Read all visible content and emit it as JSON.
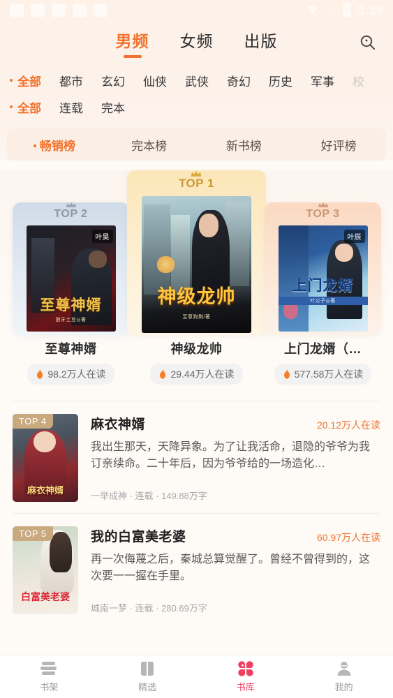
{
  "status_bar": {
    "time": "3:39",
    "icons": [
      "wifi-icon",
      "signal-icon",
      "battery-charging-icon"
    ]
  },
  "header": {
    "tabs": [
      {
        "label": "男频",
        "active": true
      },
      {
        "label": "女频",
        "active": false
      },
      {
        "label": "出版",
        "active": false
      }
    ],
    "search_icon": "search-icon"
  },
  "filters": {
    "genre_row": [
      {
        "label": "全部",
        "active": true
      },
      {
        "label": "都市",
        "active": false
      },
      {
        "label": "玄幻",
        "active": false
      },
      {
        "label": "仙侠",
        "active": false
      },
      {
        "label": "武侠",
        "active": false
      },
      {
        "label": "奇幻",
        "active": false
      },
      {
        "label": "历史",
        "active": false
      },
      {
        "label": "军事",
        "active": false
      },
      {
        "label": "校",
        "active": false,
        "clipped": true
      }
    ],
    "status_row": [
      {
        "label": "全部",
        "active": true
      },
      {
        "label": "连载",
        "active": false
      },
      {
        "label": "完本",
        "active": false
      }
    ]
  },
  "rank_tabs": [
    {
      "label": "畅销榜",
      "active": true
    },
    {
      "label": "完本榜",
      "active": false
    },
    {
      "label": "新书榜",
      "active": false
    },
    {
      "label": "好评榜",
      "active": false
    }
  ],
  "podium": [
    {
      "rank_label": "TOP 1",
      "title": "神级龙帅",
      "readers": "29.44万人在读",
      "cover_title": "神级龙帅",
      "cover_author": "至尊狗剩/著",
      "cover_badge": ""
    },
    {
      "rank_label": "TOP 2",
      "title": "至尊神婿",
      "readers": "98.2万人在读",
      "cover_title": "至尊神婿",
      "cover_author": "狼牙土豆◎著",
      "cover_badge": "叶昊"
    },
    {
      "rank_label": "TOP 3",
      "title": "上门龙婿（…",
      "readers": "577.58万人在读",
      "cover_title": "上门龙婿",
      "cover_author": "叶公子◎著",
      "cover_badge": "叶辰"
    }
  ],
  "list": [
    {
      "badge": "TOP 4",
      "title": "麻衣神婿",
      "readers": "20.12万人在读",
      "desc": "我出生那天，天降异象。为了让我活命，退隐的爷爷为我订亲续命。二十年后，因为爷爷给的一场造化…",
      "meta": "一举成神 · 连载 · 149.88万字",
      "cover_title": "麻衣神婿"
    },
    {
      "badge": "TOP 5",
      "title": "我的白富美老婆",
      "readers": "60.97万人在读",
      "desc": "再一次侮蔑之后，秦城总算觉醒了。曾经不曾得到的，这次要一一握在手里。",
      "meta": "城南一梦 · 连载 · 280.69万字",
      "cover_title": "白富美老婆"
    }
  ],
  "tabbar": [
    {
      "label": "书架",
      "icon": "bookshelf-icon",
      "active": false
    },
    {
      "label": "精选",
      "icon": "book-open-icon",
      "active": false
    },
    {
      "label": "书库",
      "icon": "clover-library-icon",
      "active": true
    },
    {
      "label": "我的",
      "icon": "person-icon",
      "active": false
    }
  ],
  "colors": {
    "accent": "#f2712c",
    "tabbar_active": "#ef4060",
    "page_bg": "#fefbf7",
    "header_bg": "#fdf1e8",
    "top1": "#c99a33",
    "top2": "#8b97a5",
    "top3": "#c89873"
  }
}
